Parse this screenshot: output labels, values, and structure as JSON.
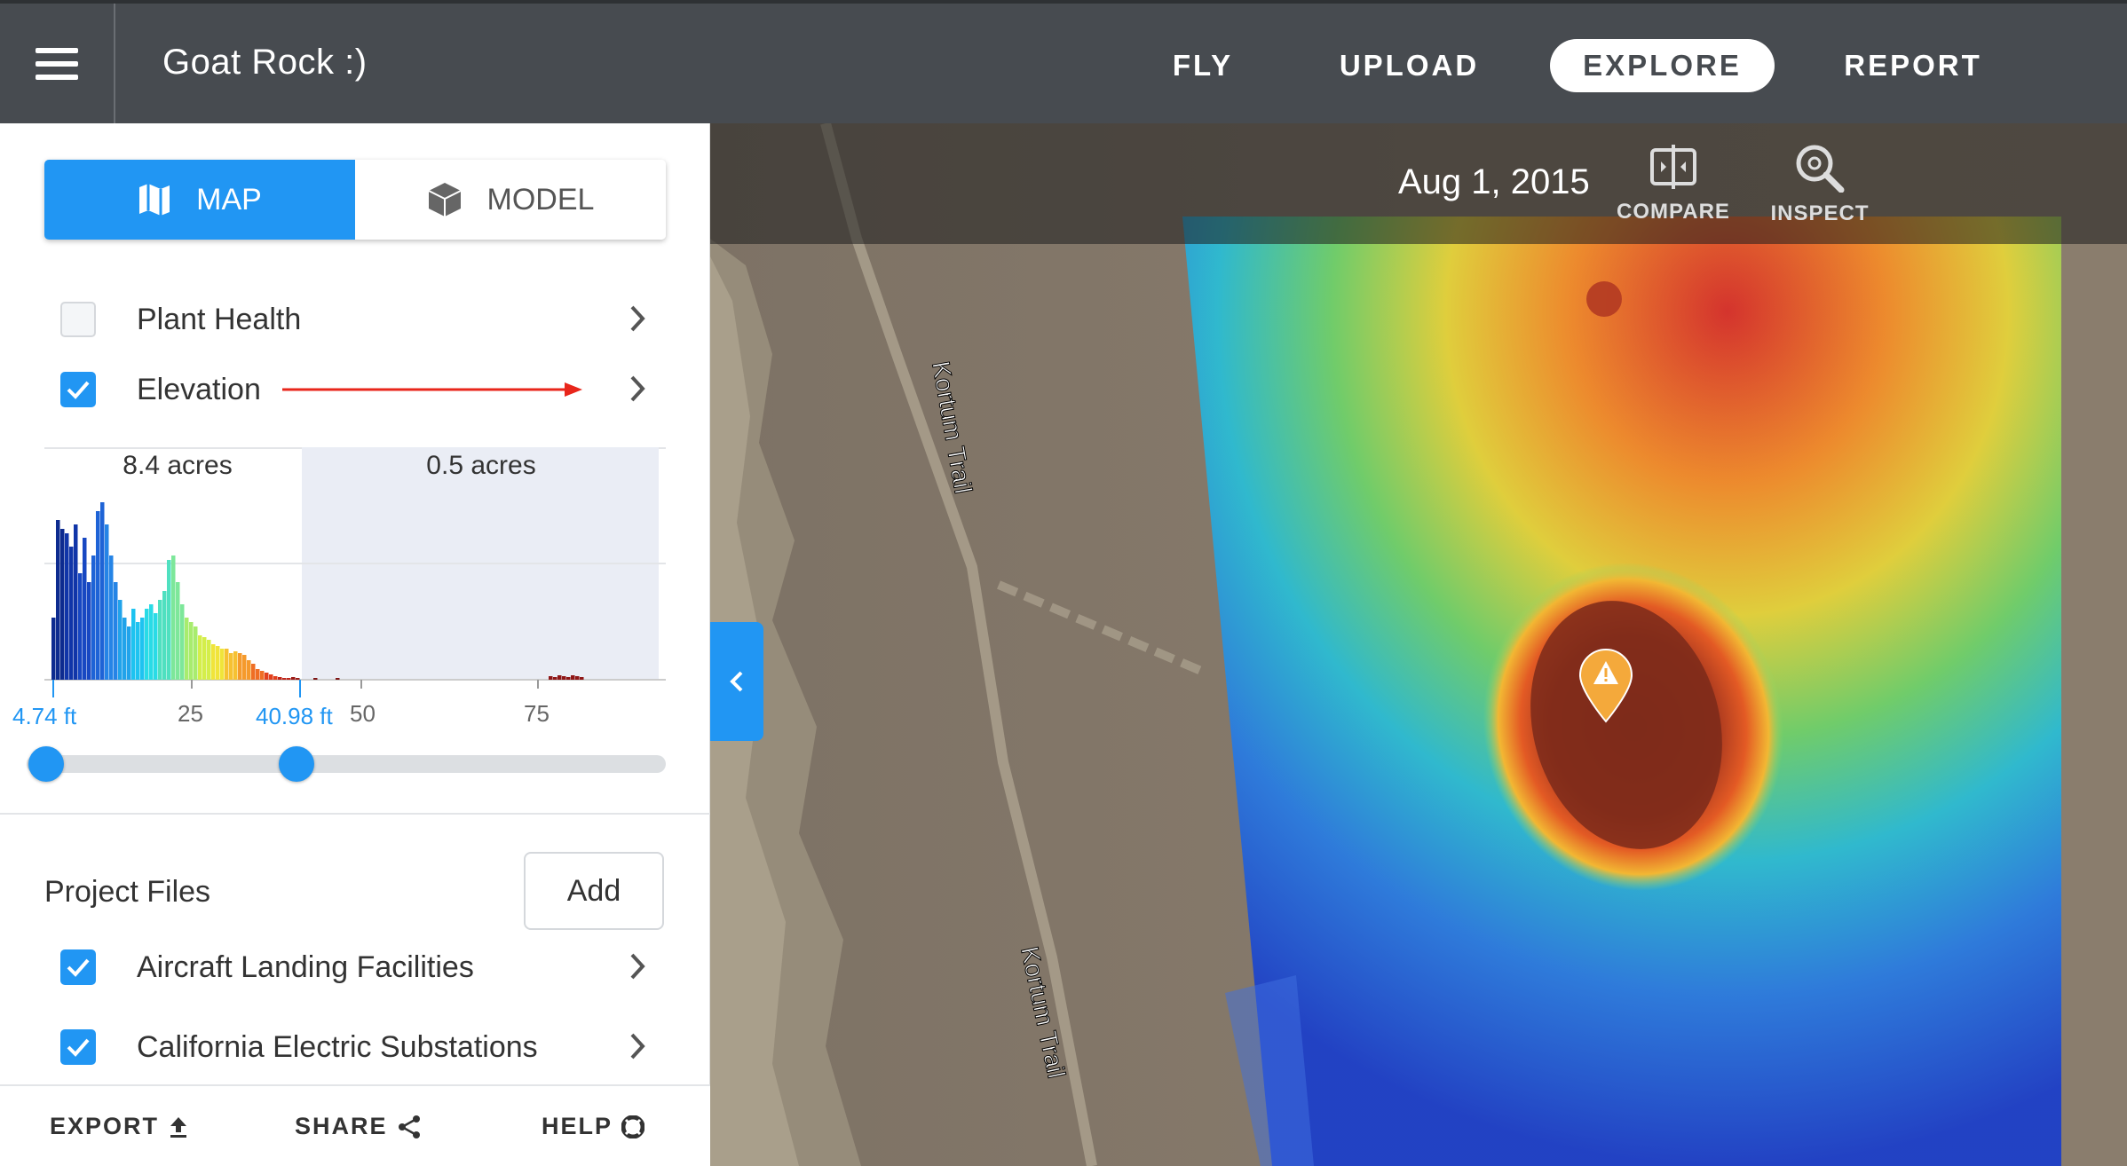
{
  "header": {
    "project_title": "Goat Rock :)",
    "nav": [
      "FLY",
      "UPLOAD",
      "EXPLORE",
      "REPORT"
    ],
    "active_nav": "EXPLORE"
  },
  "sidebar": {
    "view_toggle": {
      "map_label": "MAP",
      "model_label": "MODEL",
      "active": "MAP"
    },
    "layers": [
      {
        "label": "Plant Health",
        "checked": false
      },
      {
        "label": "Elevation",
        "checked": true
      }
    ],
    "histogram": {
      "left_area_label": "8.4 acres",
      "right_area_label": "0.5 acres",
      "ticks": [
        "25",
        "50",
        "75"
      ],
      "min_label": "4.74 ft",
      "max_label": "40.98 ft"
    },
    "project_files": {
      "title": "Project Files",
      "add_label": "Add",
      "items": [
        {
          "label": "Aircraft Landing Facilities",
          "checked": true
        },
        {
          "label": "California Electric Substations",
          "checked": true
        }
      ]
    },
    "footer": {
      "export_label": "EXPORT",
      "share_label": "SHARE",
      "help_label": "HELP"
    }
  },
  "map": {
    "date": "Aug 1, 2015",
    "tools": {
      "compare_label": "COMPARE",
      "inspect_label": "INSPECT"
    },
    "trail_label": "Kortum Trail",
    "marker_icon": "warning-icon"
  },
  "colors": {
    "accent": "#2196f3",
    "topbar": "#474b50",
    "marker": "#f4a93b",
    "arrow": "#e8261b"
  }
}
